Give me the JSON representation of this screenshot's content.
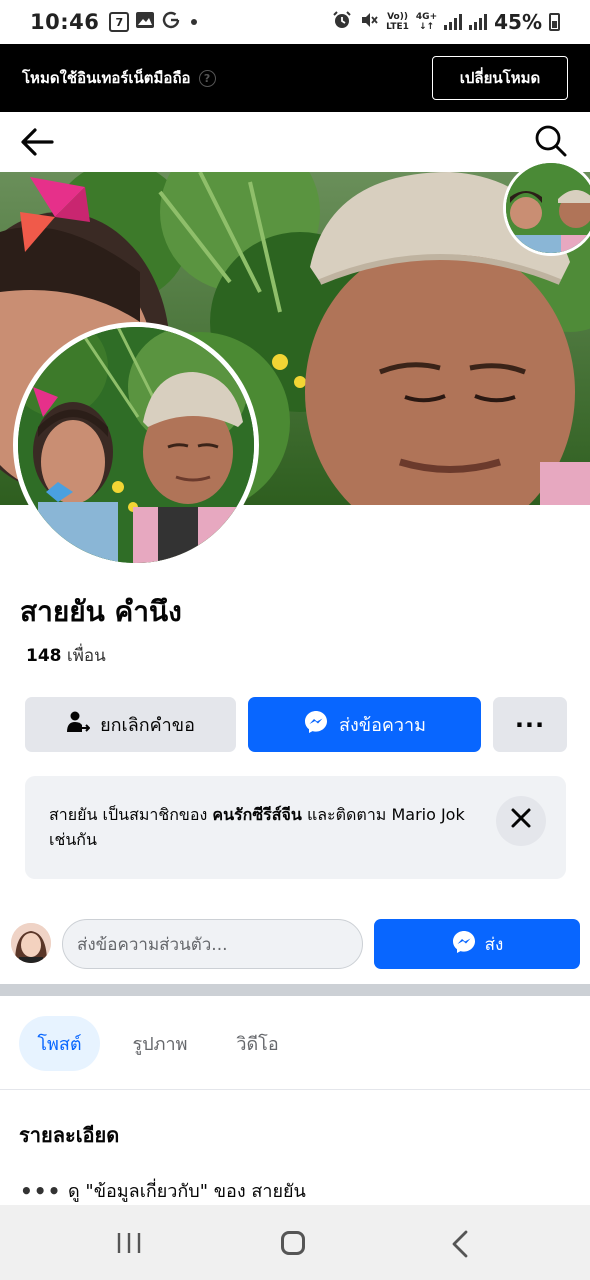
{
  "status_bar": {
    "time": "10:46",
    "battery": "45%",
    "net_top": "Vo))",
    "net_bottom": "LTE1",
    "net_type": "4G+"
  },
  "mode_banner": {
    "text": "โหมดใช้อินเทอร์เน็ตมือถือ",
    "switch_label": "เปลี่ยนโหมด"
  },
  "profile": {
    "name": "สายยัน คำนึง",
    "friends_count": "148",
    "friends_label": "เพื่อน"
  },
  "actions": {
    "cancel_request": "ยกเลิกคำขอ",
    "send_message": "ส่งข้อความ",
    "more": "···"
  },
  "mutual": {
    "prefix": "สายยัน เป็นสมาชิกของ",
    "group": "คนรักซีรีส์จีน",
    "middle": "และติดตาม",
    "follows": "Mario Jok",
    "suffix": "เช่นกัน"
  },
  "composer": {
    "placeholder": "ส่งข้อความส่วนตัว...",
    "send_label": "ส่ง"
  },
  "tabs": [
    {
      "label": "โพสต์",
      "active": true
    },
    {
      "label": "รูปภาพ",
      "active": false
    },
    {
      "label": "วิดีโอ",
      "active": false
    }
  ],
  "details": {
    "heading": "รายละเอียด",
    "about_text": "ดู \"ข้อมูลเกี่ยวกับ\" ของ สายยัน"
  },
  "colors": {
    "primary": "#0866ff",
    "button_gray": "#e4e6eb",
    "card_bg": "#f0f2f5",
    "banner_bg": "#000000"
  }
}
